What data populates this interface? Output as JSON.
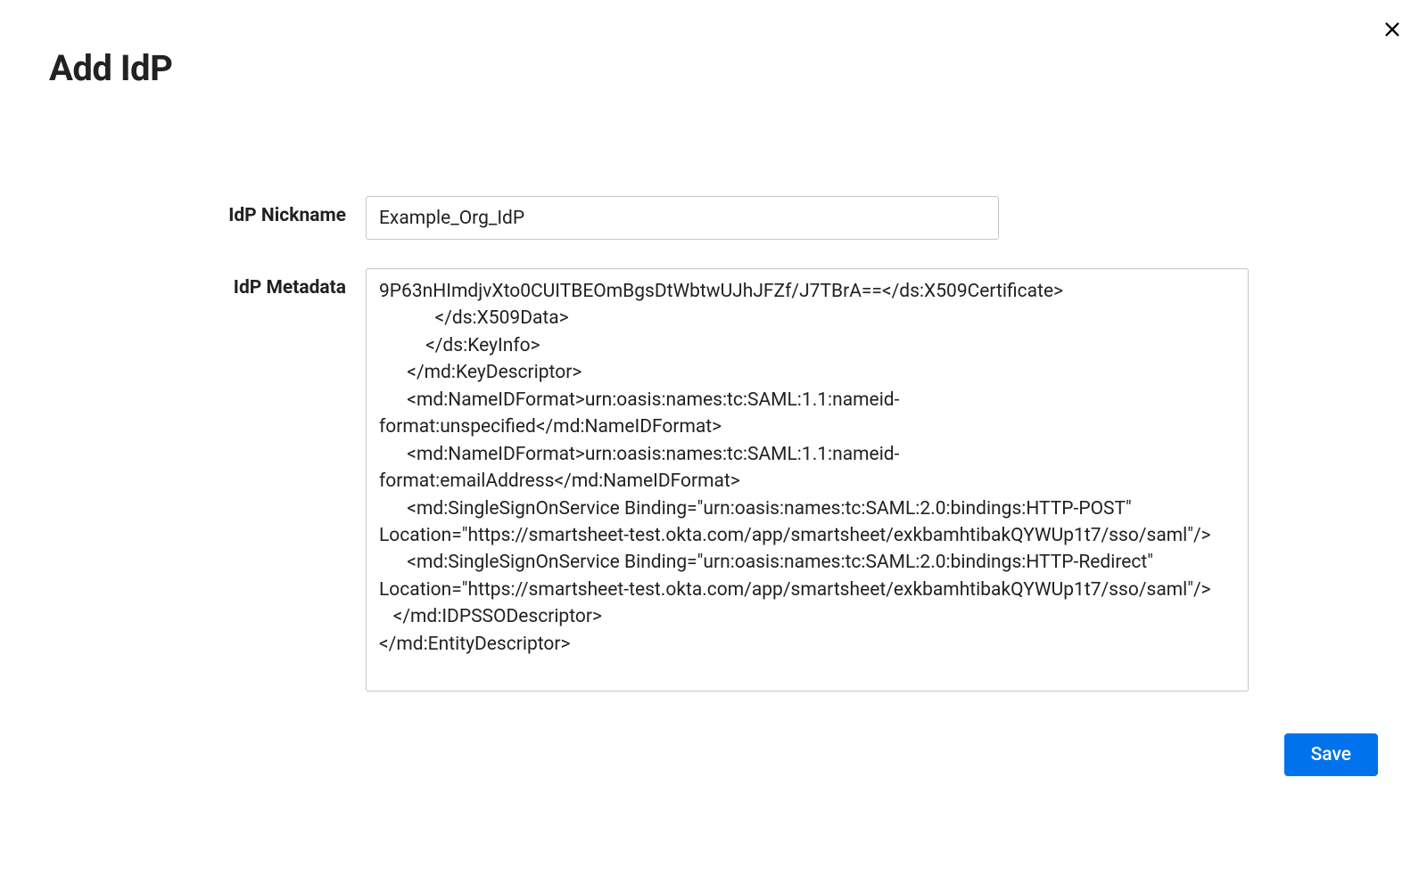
{
  "header": {
    "title": "Add IdP"
  },
  "form": {
    "nickname_label": "IdP Nickname",
    "nickname_value": "Example_Org_IdP",
    "metadata_label": "IdP Metadata",
    "metadata_value": "9P63nHImdjvXto0CUITBEOmBgsDtWbtwUJhJFZf/J7TBrA==</ds:X509Certificate>\n            </ds:X509Data>\n          </ds:KeyInfo>\n      </md:KeyDescriptor>\n      <md:NameIDFormat>urn:oasis:names:tc:SAML:1.1:nameid-format:unspecified</md:NameIDFormat>\n      <md:NameIDFormat>urn:oasis:names:tc:SAML:1.1:nameid-format:emailAddress</md:NameIDFormat>\n      <md:SingleSignOnService Binding=\"urn:oasis:names:tc:SAML:2.0:bindings:HTTP-POST\" Location=\"https://smartsheet-test.okta.com/app/smartsheet/exkbamhtibakQYWUp1t7/sso/saml\"/>\n      <md:SingleSignOnService Binding=\"urn:oasis:names:tc:SAML:2.0:bindings:HTTP-Redirect\" Location=\"https://smartsheet-test.okta.com/app/smartsheet/exkbamhtibakQYWUp1t7/sso/saml\"/>\n   </md:IDPSSODescriptor>\n</md:EntityDescriptor>"
  },
  "footer": {
    "save_label": "Save"
  }
}
